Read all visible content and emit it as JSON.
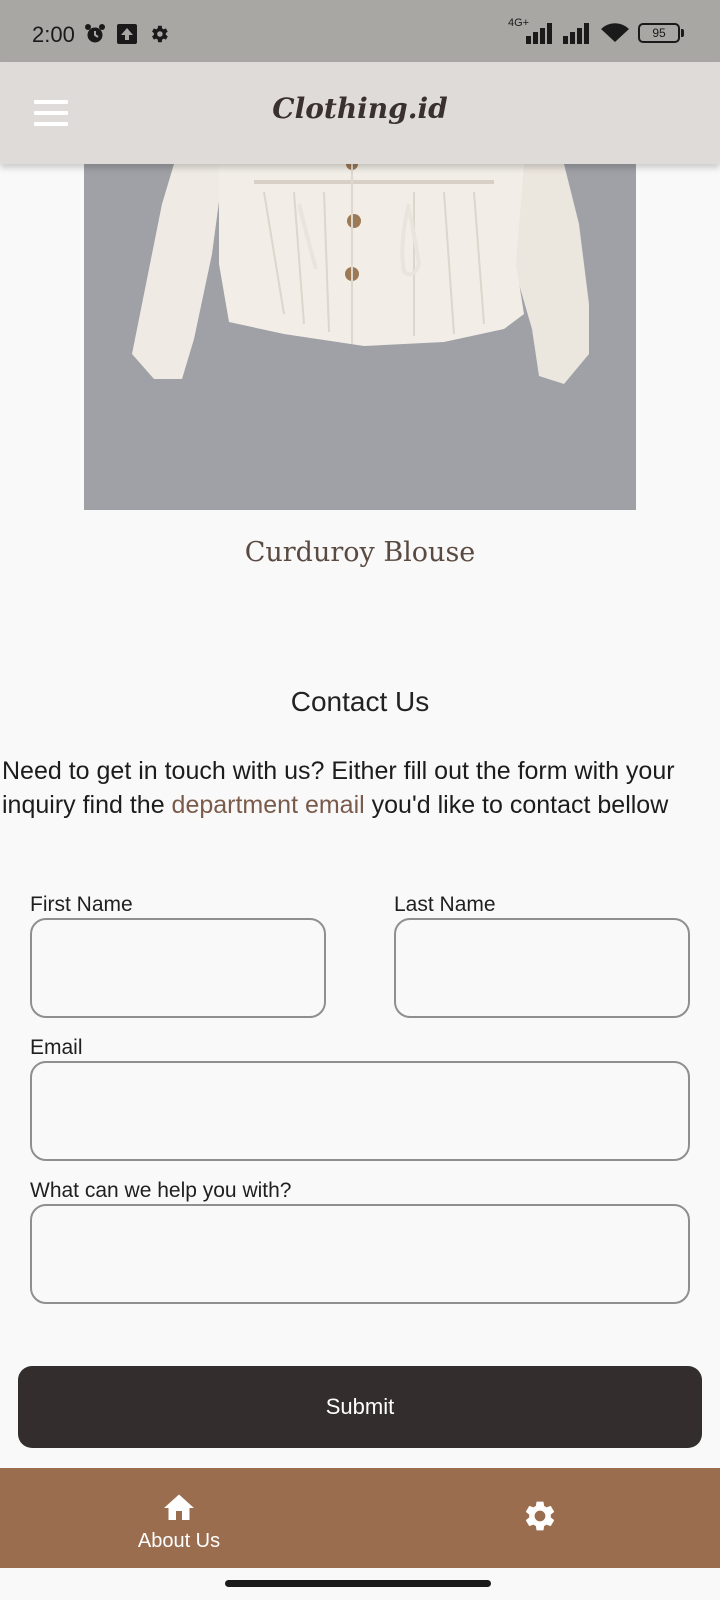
{
  "status_bar": {
    "time": "2:00",
    "network": "4G+",
    "battery": "95"
  },
  "app_bar": {
    "title": "Clothing.id"
  },
  "product": {
    "name": "Curduroy Blouse"
  },
  "contact": {
    "title": "Contact Us",
    "text_before_link": "Need to get in touch with us? Either fill out the form with your inquiry find the ",
    "link_text": "department email",
    "text_after_link": " you'd like to contact bellow"
  },
  "form": {
    "first_name_label": "First Name",
    "first_name_value": "",
    "last_name_label": "Last Name",
    "last_name_value": "",
    "email_label": "Email",
    "email_value": "",
    "help_label": "What can we help you with?",
    "help_value": "",
    "submit_label": "Submit"
  },
  "bottom_nav": {
    "items": [
      {
        "label": "About Us",
        "icon": "home-icon"
      },
      {
        "label": "",
        "icon": "gear-icon"
      }
    ]
  },
  "colors": {
    "status_bar": "#a9a7a4",
    "app_bar": "#dfdbd9",
    "bottom_nav": "#9a6d4f",
    "submit_button": "#332d2d",
    "link": "#7a5b4b"
  }
}
